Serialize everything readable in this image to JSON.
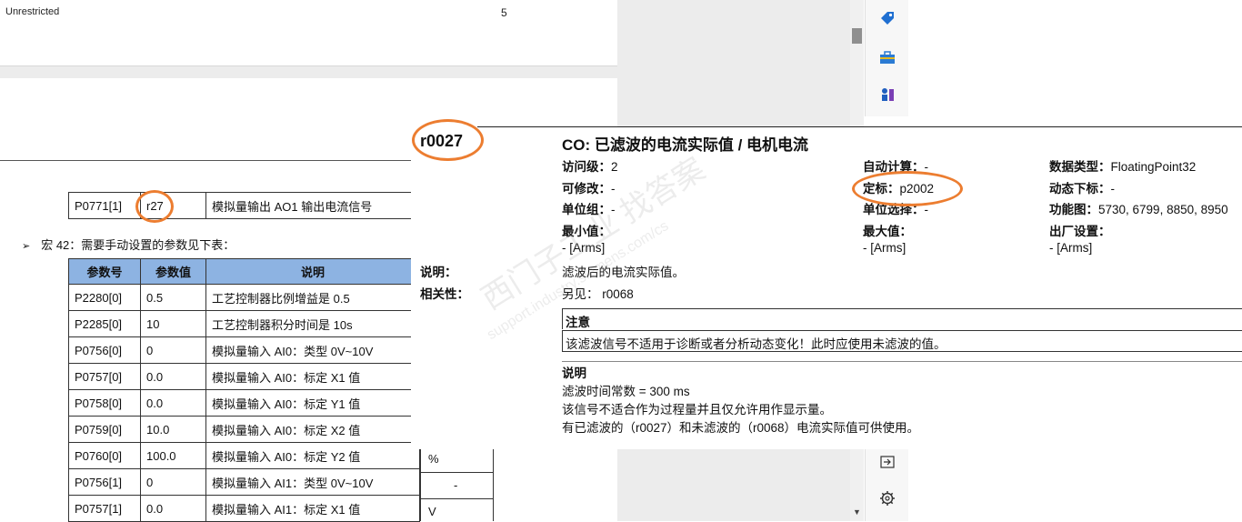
{
  "page_header": {
    "classification": "Unrestricted",
    "page_number": "5"
  },
  "p0771_row": {
    "param": "P0771[1]",
    "value": "r27",
    "desc": "模拟量输出 AO1 输出电流信号"
  },
  "macro_line": {
    "bullet": "➢",
    "text": "宏 42：需要手动设置的参数见下表："
  },
  "macro_table": {
    "headers": [
      "参数号",
      "参数值",
      "说明"
    ],
    "rows": [
      [
        "P2280[0]",
        "0.5",
        "工艺控制器比例增益是 0.5"
      ],
      [
        "P2285[0]",
        "10",
        "工艺控制器积分时间是 10s"
      ],
      [
        "P0756[0]",
        "0",
        "模拟量输入 AI0：类型 0V~10V"
      ],
      [
        "P0757[0]",
        "0.0",
        "模拟量输入 AI0：标定 X1 值"
      ],
      [
        "P0758[0]",
        "0.0",
        "模拟量输入 AI0：标定 Y1 值"
      ],
      [
        "P0759[0]",
        "10.0",
        "模拟量输入 AI0：标定 X2 值"
      ],
      [
        "P0760[0]",
        "100.0",
        "模拟量输入 AI0：标定 Y2 值"
      ],
      [
        "P0756[1]",
        "0",
        "模拟量输入 AI1：类型 0V~10V"
      ],
      [
        "P0757[1]",
        "0.0",
        "模拟量输入 AI1：标定 X1 值"
      ]
    ],
    "extra_col": [
      "%",
      "-",
      "V"
    ]
  },
  "param_detail": {
    "id": "r0027",
    "title": "CO: 已滤波的电流实际值 / 电机电流",
    "access_level_label": "访问级：",
    "access_level": "2",
    "auto_calc_label": "自动计算：",
    "auto_calc": "-",
    "data_type_label": "数据类型：",
    "data_type": "FloatingPoint32",
    "modifiable_label": "可修改：",
    "modifiable": "-",
    "scaling_label": "定标：",
    "scaling": "p2002",
    "dynamic_index_label": "动态下标：",
    "dynamic_index": "-",
    "unit_group_label": "单位组：",
    "unit_group": "-",
    "unit_select_label": "单位选择：",
    "unit_select": "-",
    "function_diagram_label": "功能图：",
    "function_diagram": "5730, 6799, 8850, 8950",
    "min_label": "最小值：",
    "min_value": "- [Arms]",
    "max_label": "最大值：",
    "max_value": "- [Arms]",
    "factory_label": "出厂设置：",
    "factory_value": "- [Arms]",
    "description_label": "说明：",
    "description": "滤波后的电流实际值。",
    "dependency_label": "相关性：",
    "dependency": "另见： r0068",
    "note_head": "注意",
    "note_body": "该滤波信号不适用于诊断或者分析动态变化！此时应使用未滤波的值。",
    "explain_head": "说明",
    "explain_lines": [
      "滤波时间常数 = 300 ms",
      "该信号不适合作为过程量并且仅允许用作显示量。",
      "有已滤波的（r0027）和未滤波的（r0068）电流实际值可供使用。"
    ]
  },
  "watermark": {
    "text": "西门子工业 找答案",
    "url": "support.industry.siemens.com/cs"
  },
  "side_icons": [
    "tag-icon",
    "toolbox-icon",
    "chess-icon",
    "panel-export-icon",
    "gear-icon"
  ],
  "colors": {
    "highlight_ring": "#ec7d30",
    "table_header": "#8db3e2"
  }
}
